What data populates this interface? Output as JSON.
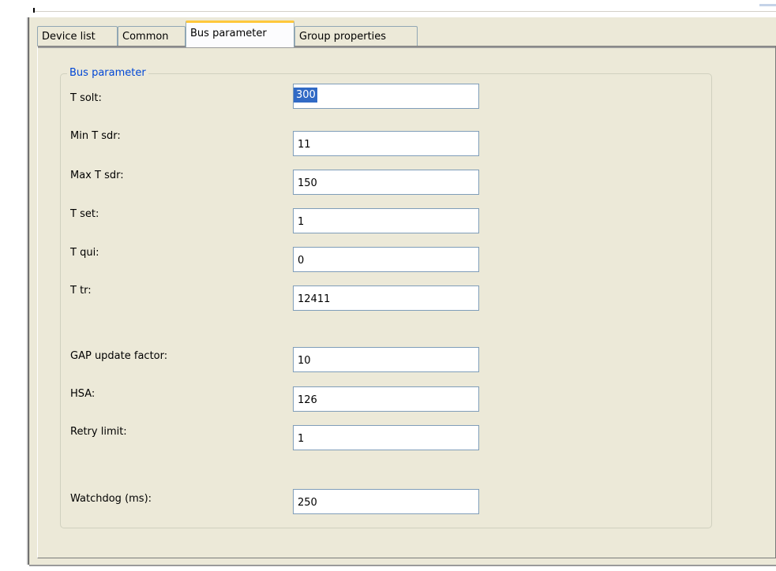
{
  "tabs": [
    {
      "label": "Device list",
      "active": false
    },
    {
      "label": "Common",
      "active": false
    },
    {
      "label": "Bus parameter",
      "active": true
    },
    {
      "label": "Group properties",
      "active": false
    }
  ],
  "group": {
    "title": "Bus parameter"
  },
  "fields": {
    "t_solt": {
      "label": "T solt:",
      "value": "300"
    },
    "min_t_sdr": {
      "label": "Min T sdr:",
      "value": "11"
    },
    "max_t_sdr": {
      "label": "Max T sdr:",
      "value": "150"
    },
    "t_set": {
      "label": "T set:",
      "value": "1"
    },
    "t_qui": {
      "label": "T qui:",
      "value": "0"
    },
    "t_tr": {
      "label": "T tr:",
      "value": "12411"
    },
    "gap_update_factor": {
      "label": "GAP update factor:",
      "value": "10"
    },
    "hsa": {
      "label": "HSA:",
      "value": "126"
    },
    "retry_limit": {
      "label": "Retry limit:",
      "value": "1"
    },
    "watchdog": {
      "label": "Watchdog (ms):",
      "value": "250"
    }
  },
  "colors": {
    "window_bg": "#ece9d8",
    "legend_text": "#0046d5",
    "active_tab_accent": "#ffc83c",
    "input_border": "#7f9db9",
    "selection": "#316ac5"
  }
}
